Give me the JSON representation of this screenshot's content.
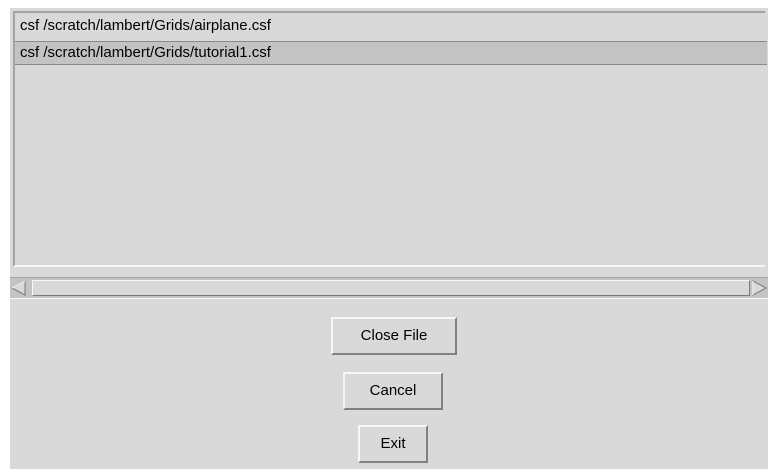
{
  "file_list": {
    "items": [
      "csf /scratch/lambert/Grids/airplane.csf",
      "csf /scratch/lambert/Grids/tutorial1.csf"
    ],
    "selected_index": 1
  },
  "buttons": {
    "close_file": "Close File",
    "cancel": "Cancel",
    "exit": "Exit"
  },
  "colors": {
    "panel_background": "#d9d9d9",
    "selected_row": "#c3c3c3"
  },
  "icons": {
    "scroll_left": "triangle-left",
    "scroll_right": "triangle-right"
  }
}
